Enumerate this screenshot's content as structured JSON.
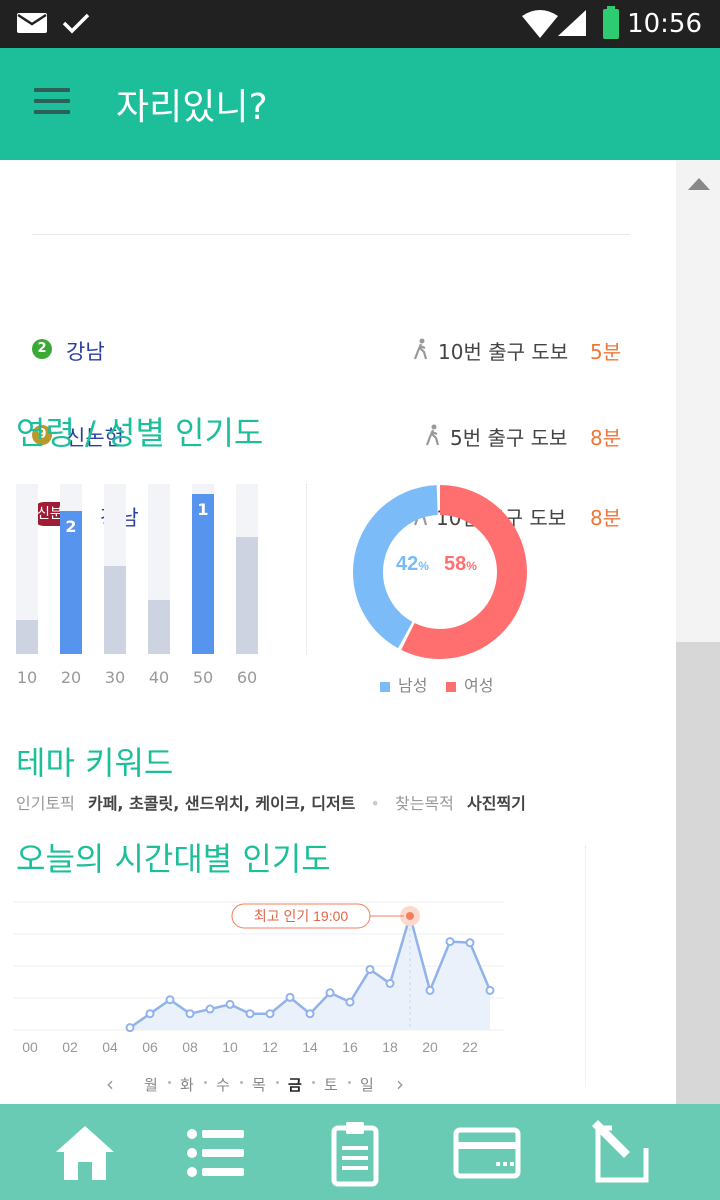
{
  "status": {
    "time": "10:56"
  },
  "app": {
    "title": "자리있니?"
  },
  "stations": [
    {
      "line_badge": "2",
      "line_color": "#3aa935",
      "name": "강남",
      "exit": "10번 출구  도보",
      "minutes": "5분"
    },
    {
      "line_badge": "9",
      "line_color": "#b89a2c",
      "name": "신논현",
      "exit": "5번 출구  도보",
      "minutes": "8분"
    },
    {
      "line_badge": "신분당",
      "line_color": "#a01c35",
      "name": "강남",
      "exit": "10번 출구  도보",
      "minutes": "8분"
    }
  ],
  "age_gender": {
    "title": "연령 / 성별 인기도",
    "age_chart": {
      "type": "bar",
      "categories": [
        "10",
        "20",
        "30",
        "40",
        "50",
        "60"
      ],
      "values": [
        20,
        84,
        52,
        32,
        94,
        69
      ],
      "ylim": [
        0,
        100
      ],
      "rank_labels": [
        null,
        "2",
        null,
        null,
        "1",
        null
      ],
      "highlight_color": "#5794ee",
      "base_color": "#cdd3e1"
    },
    "gender_chart": {
      "type": "pie",
      "slices": [
        {
          "label": "남성",
          "value": 42,
          "display": "42",
          "color": "#7bbcf8"
        },
        {
          "label": "여성",
          "value": 58,
          "display": "58",
          "color": "#ff6f6f"
        }
      ],
      "unit": "%"
    }
  },
  "theme": {
    "title": "테마 키워드",
    "topic_label": "인기토픽",
    "topic_value": "카페, 초콜릿, 샌드위치, 케이크, 디저트",
    "purpose_label": "찾는목적",
    "purpose_value": "사진찍기"
  },
  "hourly": {
    "title": "오늘의 시간대별 인기도",
    "peak_label": "최고 인기 19:00",
    "days": [
      "월",
      "화",
      "수",
      "목",
      "금",
      "토",
      "일"
    ],
    "active_day": "금",
    "chart_data": {
      "type": "area",
      "x_ticks": [
        "00",
        "02",
        "04",
        "06",
        "08",
        "10",
        "12",
        "14",
        "16",
        "18",
        "20",
        "22"
      ],
      "x": [
        5,
        6,
        7,
        8,
        9,
        10,
        11,
        12,
        13,
        14,
        15,
        16,
        17,
        18,
        19,
        20,
        21,
        22,
        23
      ],
      "values": [
        2,
        14,
        26,
        14,
        18,
        22,
        14,
        14,
        28,
        14,
        32,
        24,
        52,
        40,
        98,
        34,
        76,
        75,
        34
      ],
      "ylim": [
        0,
        110
      ],
      "peak_x": 19,
      "line_color": "#8fb3ea",
      "fill_color": "#eaf1fb",
      "peak_color": "#f47f5a"
    }
  },
  "bottom_nav": [
    "home-icon",
    "list-icon",
    "clipboard-icon",
    "card-icon",
    "edit-icon"
  ]
}
